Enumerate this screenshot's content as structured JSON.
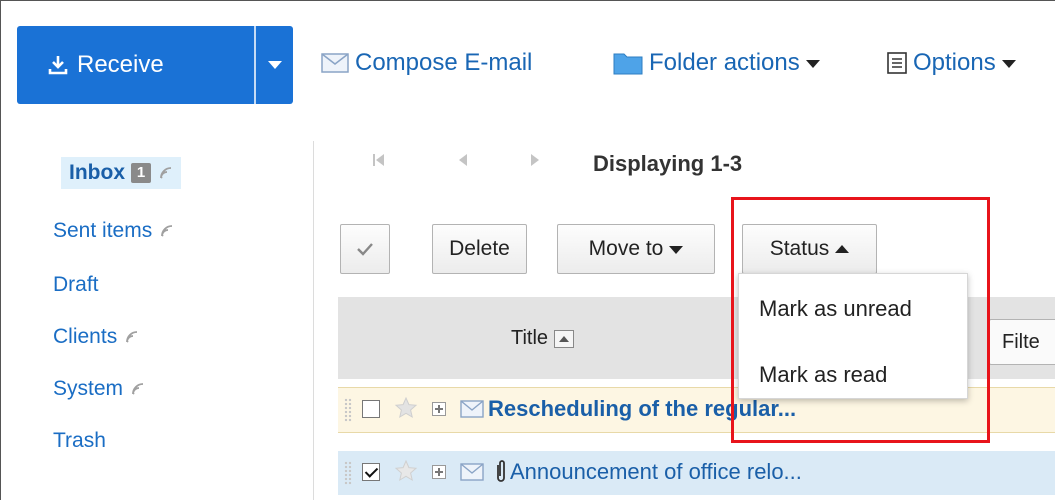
{
  "toolbar": {
    "receive_label": "Receive",
    "compose_label": "Compose E-mail",
    "folder_actions_label": "Folder actions",
    "options_label": "Options"
  },
  "sidebar": {
    "inbox_label": "Inbox",
    "inbox_unread_count": "1",
    "items": [
      {
        "label": "Sent items",
        "feed": true
      },
      {
        "label": "Draft",
        "feed": false
      },
      {
        "label": "Clients",
        "feed": true
      },
      {
        "label": "System",
        "feed": true
      },
      {
        "label": "Trash",
        "feed": false
      }
    ]
  },
  "pager": {
    "status": "Displaying 1-3"
  },
  "actions": {
    "delete_label": "Delete",
    "move_to_label": "Move to",
    "status_label": "Status"
  },
  "status_menu": {
    "items": [
      "Mark as unread",
      "Mark as read"
    ]
  },
  "table": {
    "title_header": "Title",
    "filter_label": "Filte",
    "rows": [
      {
        "subject": "Rescheduling of the regular...",
        "unread": true,
        "checked": false,
        "attachment": false
      },
      {
        "subject": "Announcement of office relo...",
        "unread": false,
        "checked": true,
        "attachment": true
      }
    ]
  },
  "colors": {
    "primary_button": "#1a72d6",
    "link": "#1a6dc4",
    "highlight_box": "#e8141b",
    "selected_row": "#daeaf6",
    "unread_row": "#fdf6e3"
  }
}
